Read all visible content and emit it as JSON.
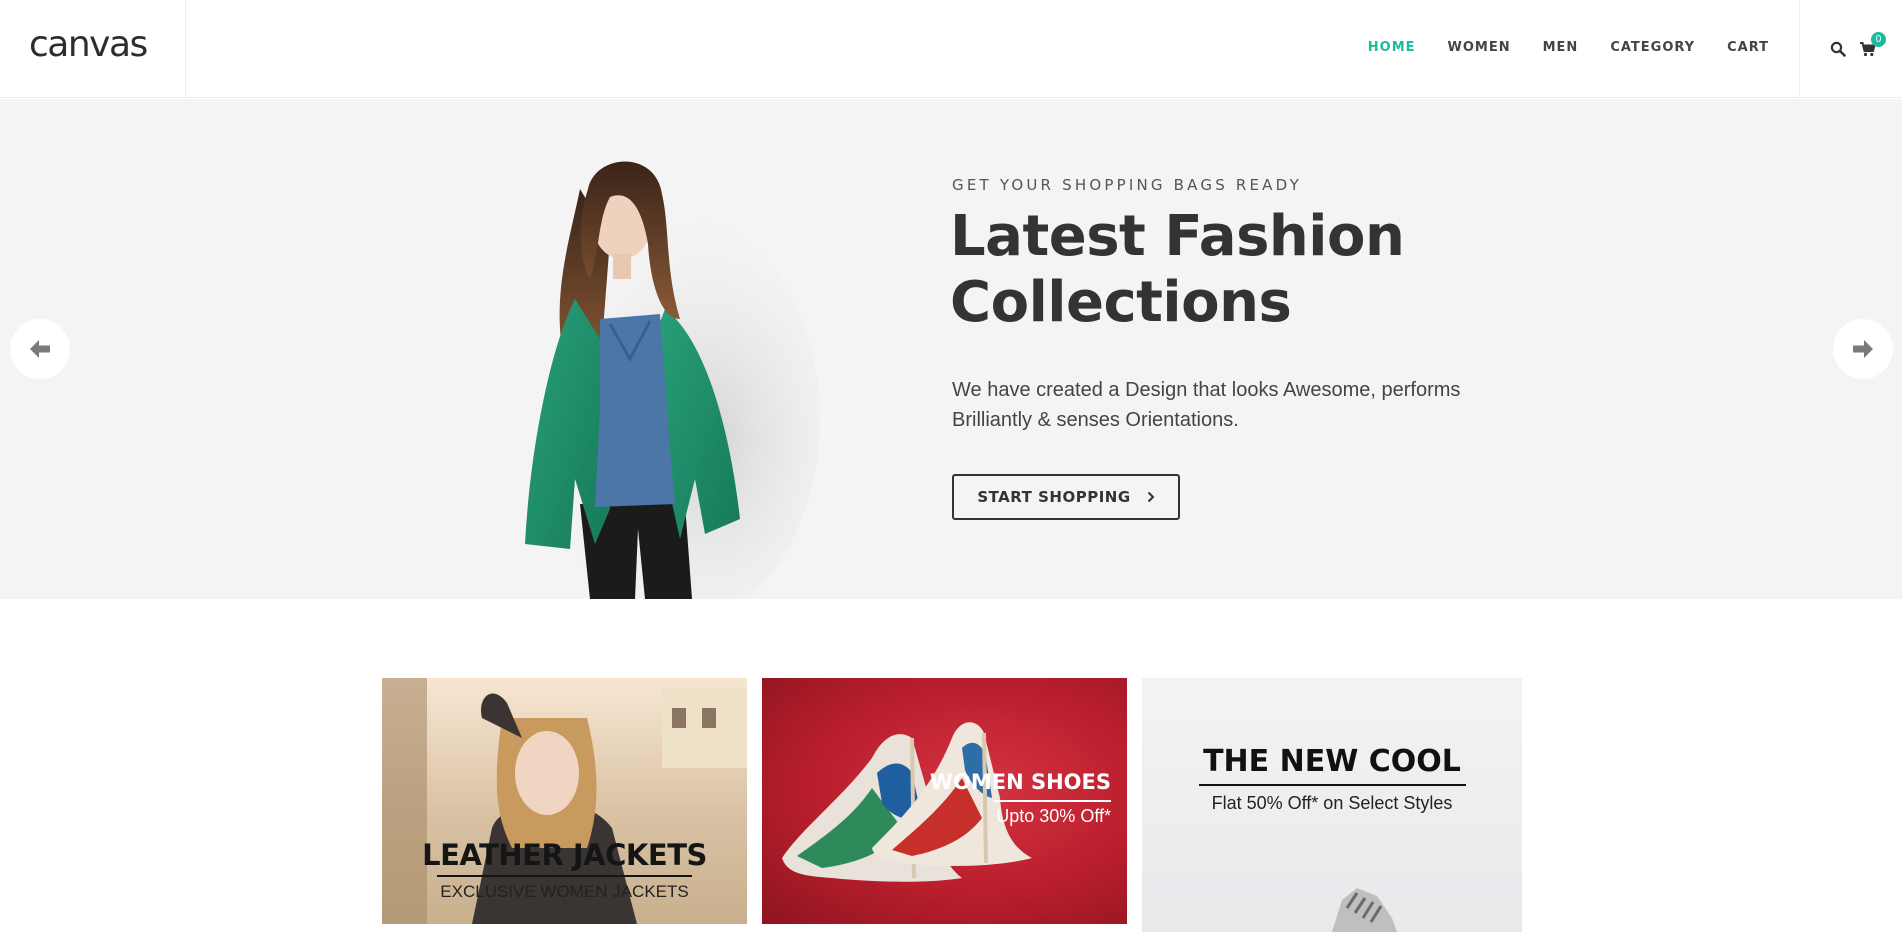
{
  "brand": {
    "logo": "canvas"
  },
  "nav": {
    "items": [
      {
        "label": "HOME",
        "active": true
      },
      {
        "label": "WOMEN",
        "active": false
      },
      {
        "label": "MEN",
        "active": false
      },
      {
        "label": "CATEGORY",
        "active": false
      },
      {
        "label": "CART",
        "active": false
      }
    ],
    "search_icon": "search-icon",
    "cart_icon": "cart-icon",
    "cart_count": "0"
  },
  "hero": {
    "subtitle": "GET YOUR SHOPPING BAGS READY",
    "title": "Latest Fashion Collections",
    "text": "We have created a Design that looks Awesome, performs Brilliantly & senses Orientations.",
    "button_label": "START SHOPPING",
    "button_icon": "chevron-right-icon",
    "prev_icon": "arrow-left-icon",
    "next_icon": "arrow-right-icon"
  },
  "promos": [
    {
      "title": "LEATHER JACKETS",
      "subtitle": "EXCLUSIVE WOMEN JACKETS"
    },
    {
      "title": "WOMEN SHOES",
      "subtitle": "Upto 30% Off*"
    },
    {
      "title": "THE NEW COOL",
      "subtitle": "Flat 50% Off* on Select Styles"
    }
  ],
  "colors": {
    "accent": "#1abc9c",
    "text_dark": "#333333",
    "hero_bg": "#f4f4f4",
    "shoes_bg": "#c0202e"
  }
}
